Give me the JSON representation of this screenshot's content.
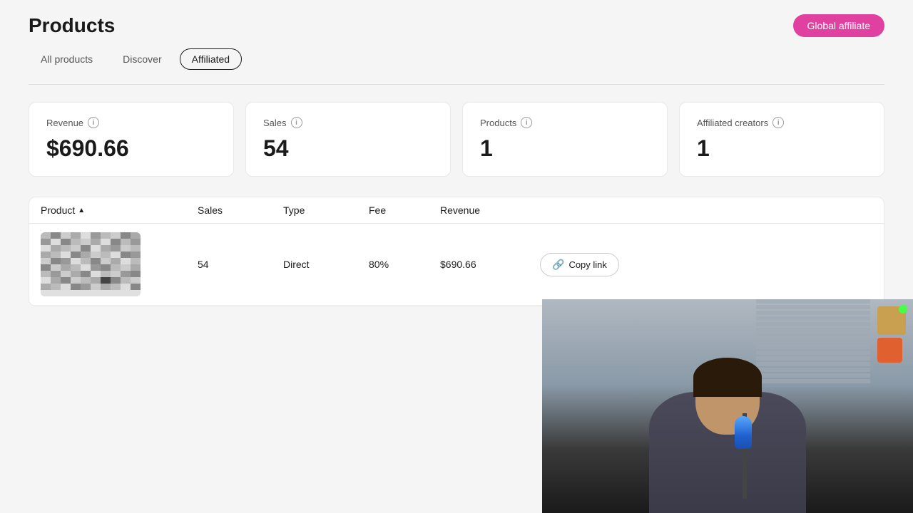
{
  "page": {
    "title": "Products",
    "global_affiliate_label": "Global affiliate"
  },
  "tabs": [
    {
      "id": "all-products",
      "label": "All products",
      "active": false
    },
    {
      "id": "discover",
      "label": "Discover",
      "active": false
    },
    {
      "id": "affiliated",
      "label": "Affiliated",
      "active": true
    }
  ],
  "stats": [
    {
      "id": "revenue",
      "label": "Revenue",
      "value": "$690.66"
    },
    {
      "id": "sales",
      "label": "Sales",
      "value": "54"
    },
    {
      "id": "products",
      "label": "Products",
      "value": "1"
    },
    {
      "id": "affiliated-creators",
      "label": "Affiliated creators",
      "value": "1"
    }
  ],
  "table": {
    "columns": [
      {
        "id": "product",
        "label": "Product",
        "sortable": true
      },
      {
        "id": "sales",
        "label": "Sales",
        "sortable": false
      },
      {
        "id": "type",
        "label": "Type",
        "sortable": false
      },
      {
        "id": "fee",
        "label": "Fee",
        "sortable": false
      },
      {
        "id": "revenue",
        "label": "Revenue",
        "sortable": false
      },
      {
        "id": "actions",
        "label": "",
        "sortable": false
      }
    ],
    "rows": [
      {
        "id": "row-1",
        "sales": "54",
        "type": "Direct",
        "fee": "80%",
        "revenue": "$690.66",
        "copy_label": "Copy link"
      }
    ]
  }
}
